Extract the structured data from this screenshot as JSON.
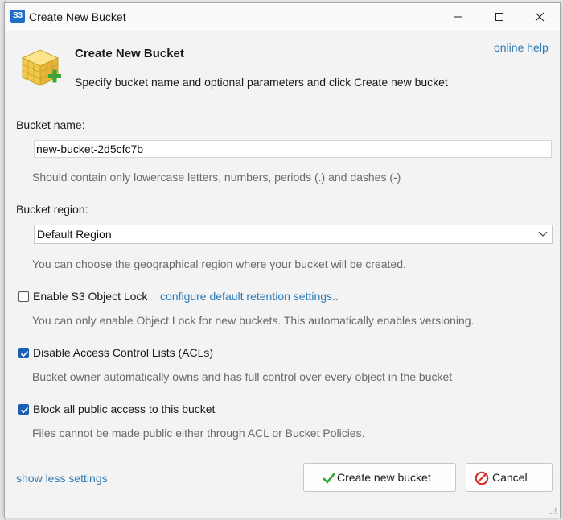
{
  "window": {
    "title": "Create New Bucket",
    "app_icon_text": "S3",
    "controls": {
      "minimize_icon": "minimize-icon",
      "maximize_icon": "maximize-icon",
      "close_icon": "close-icon"
    }
  },
  "header": {
    "title": "Create New Bucket",
    "description": "Specify bucket name and optional parameters and click Create new bucket",
    "online_help": "online help",
    "icon": "bucket-add-icon"
  },
  "bucket_name": {
    "label": "Bucket name:",
    "value": "new-bucket-2d5cfc7b",
    "hint": "Should contain only lowercase letters, numbers, periods (.) and dashes (-)"
  },
  "bucket_region": {
    "label": "Bucket region:",
    "selected": "Default Region",
    "hint": "You can choose the geographical region where your bucket will be created."
  },
  "object_lock": {
    "label": "Enable S3 Object Lock",
    "checked": false,
    "link": "configure default retention settings..",
    "hint": "You can only enable Object Lock for new buckets. This automatically enables versioning."
  },
  "disable_acl": {
    "label": "Disable Access Control Lists (ACLs)",
    "checked": true,
    "hint": "Bucket owner automatically owns and has full control over every object in the bucket"
  },
  "block_public": {
    "label": "Block all public access to this bucket",
    "checked": true,
    "hint": "Files cannot be made public either through ACL or Bucket Policies."
  },
  "footer": {
    "show_less": "show less settings",
    "create_button": "Create new bucket",
    "cancel_button": "Cancel"
  },
  "colors": {
    "link": "#2a7ab8",
    "checkbox_checked": "#1a5fb4",
    "hint_text": "#6a6a6a"
  }
}
